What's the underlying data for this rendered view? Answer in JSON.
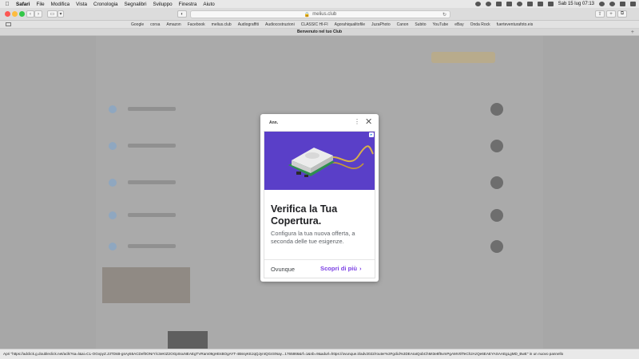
{
  "menubar": {
    "app": "Safari",
    "items": [
      "File",
      "Modifica",
      "Vista",
      "Cronologia",
      "Segnalibri",
      "Sviluppo",
      "Finestra",
      "Aiuto"
    ],
    "clock": "Sab 15 lug  07:13"
  },
  "toolbar": {
    "address": "melius.club"
  },
  "favorites": [
    "Google",
    "corsa",
    "Amazon",
    "Facebook",
    "melius.club",
    "Audiograffiti",
    "Audiocostruzioni",
    "CLASSIC HI-FI",
    "Agorahiqualitofile",
    "JuzaPhoto",
    "Canon",
    "Subito",
    "YouTube",
    "eBay",
    "Onda Rock",
    "fuerteventurafoto.eis"
  ],
  "tab": {
    "title": "Benvenuto nel tuo Club"
  },
  "modal": {
    "label": "Ann.",
    "ad": {
      "headline": "Verifica la Tua Copertura.",
      "description": "Configura la tua nuova offerta, a seconda delle tue esigenze.",
      "advertiser": "Ovunque",
      "cta": "Scopri di più"
    }
  },
  "status": {
    "text": "Apri \"https://adclick.g.doubleclick.net/aclk?sa=l&ai=CL-OGvpyZ.J3TDsB-gsAy55ACDef0ONrY/c3eKtZ2OGp0ouNEAEgTVRam09gHEsBOgAYT-4BssyKEJqQJynIQG4SNay...1765866&rf=1&nb=9&adurl=https://ovunque.it/adv2022/router%3Fgclid%3DEAIaIQobChMI3e8f5vmPgAMV0lTeCh2AzQe6EAEYASAAEgLgMD_BwE\" in un nuovo pannello"
  },
  "colors": {
    "ad_accent": "#7b3fe4",
    "ad_image_bg": "#5a3fc8"
  }
}
